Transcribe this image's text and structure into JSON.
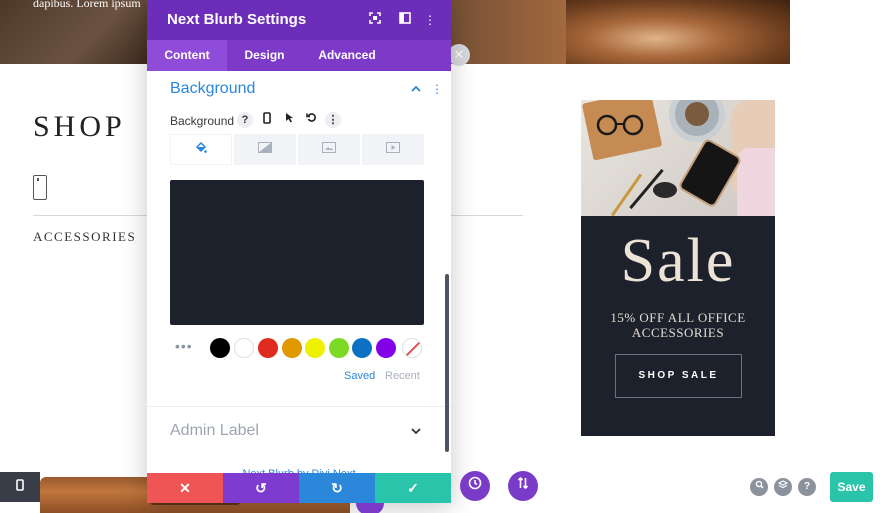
{
  "hero": {
    "text": "dapibus. Lorem ipsum"
  },
  "main": {
    "shop_heading": "SHOP",
    "category_label": "ACCESSORIES"
  },
  "sale_card": {
    "title": "Sale",
    "subtitle": "15% OFF ALL OFFICE ACCESSORIES",
    "button_label": "SHOP SALE"
  },
  "panel": {
    "title": "Next Blurb Settings",
    "tabs": [
      {
        "label": "Content",
        "active": true
      },
      {
        "label": "Design",
        "active": false
      },
      {
        "label": "Advanced",
        "active": false
      }
    ],
    "section_title": "Background",
    "background_label": "Background",
    "help_glyph": "?",
    "preview_color": "#1c212b",
    "swatches": [
      "#000000",
      "#ffffff",
      "#e02b20",
      "#e09900",
      "#edf000",
      "#7cda24",
      "#0c71c3",
      "#8300e9"
    ],
    "palette_tabs": {
      "saved": "Saved",
      "recent": "Recent"
    },
    "admin_label": "Admin Label",
    "footer_credit": "Next Blurb by Divi Next"
  },
  "actions": {
    "discard": "✕",
    "undo": "↺",
    "redo": "↻",
    "confirm": "✓"
  },
  "toolbar": {
    "save_label": "Save",
    "help_glyph": "?"
  },
  "colors": {
    "panel_header": "#6c2eb9",
    "accent_blue": "#2b87da",
    "discard_red": "#ef5555",
    "undo_purple": "#7e3bd0",
    "redo_blue": "#2b87da",
    "confirm_green": "#29c4a9",
    "save_green": "#29c4a9"
  }
}
